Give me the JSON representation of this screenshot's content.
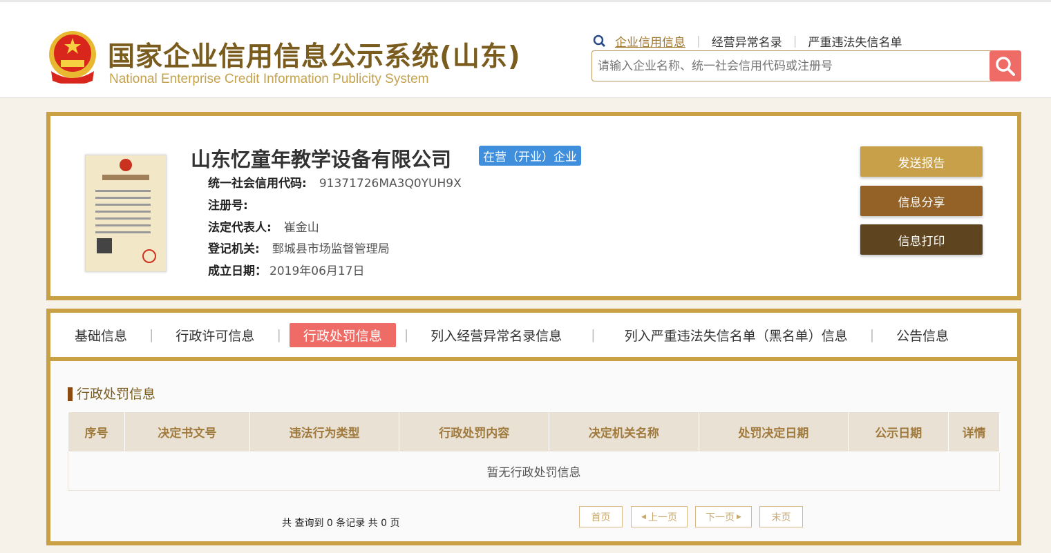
{
  "header": {
    "title_cn": "国家企业信用信息公示系统(山东)",
    "title_en": "National Enterprise Credit Information Publicity System",
    "nav": [
      "企业信用信息",
      "经营异常名录",
      "严重违法失信名单"
    ],
    "search_placeholder": "请输入企业名称、统一社会信用代码或注册号"
  },
  "company": {
    "name": "山东忆童年教学设备有限公司",
    "status": "在营（开业）企业",
    "fields": [
      {
        "label": "统一社会信用代码:",
        "value": "91371726MA3Q0YUH9X"
      },
      {
        "label": "注册号:",
        "value": ""
      },
      {
        "label": "法定代表人:",
        "value": "崔金山"
      },
      {
        "label": "登记机关:",
        "value": "鄄城县市场监督管理局"
      },
      {
        "label": "成立日期：",
        "value": "2019年06月17日"
      }
    ],
    "actions": [
      {
        "label": "发送报告",
        "color": "#c9a04a"
      },
      {
        "label": "信息分享",
        "color": "#946126"
      },
      {
        "label": "信息打印",
        "color": "#5e4520"
      }
    ]
  },
  "tabs": [
    "基础信息",
    "行政许可信息",
    "行政处罚信息",
    "列入经营异常名录信息",
    "列入严重违法失信名单（黑名单）信息",
    "公告信息"
  ],
  "section": {
    "title": "行政处罚信息",
    "columns": [
      "序号",
      "决定书文号",
      "违法行为类型",
      "行政处罚内容",
      "决定机关名称",
      "处罚决定日期",
      "公示日期",
      "详情"
    ],
    "empty": "暂无行政处罚信息"
  },
  "pager": {
    "summary": "共 查询到 0 条记录 共 0 页",
    "first": "首页",
    "prev": "上一页",
    "next": "下一页",
    "last": "末页"
  }
}
